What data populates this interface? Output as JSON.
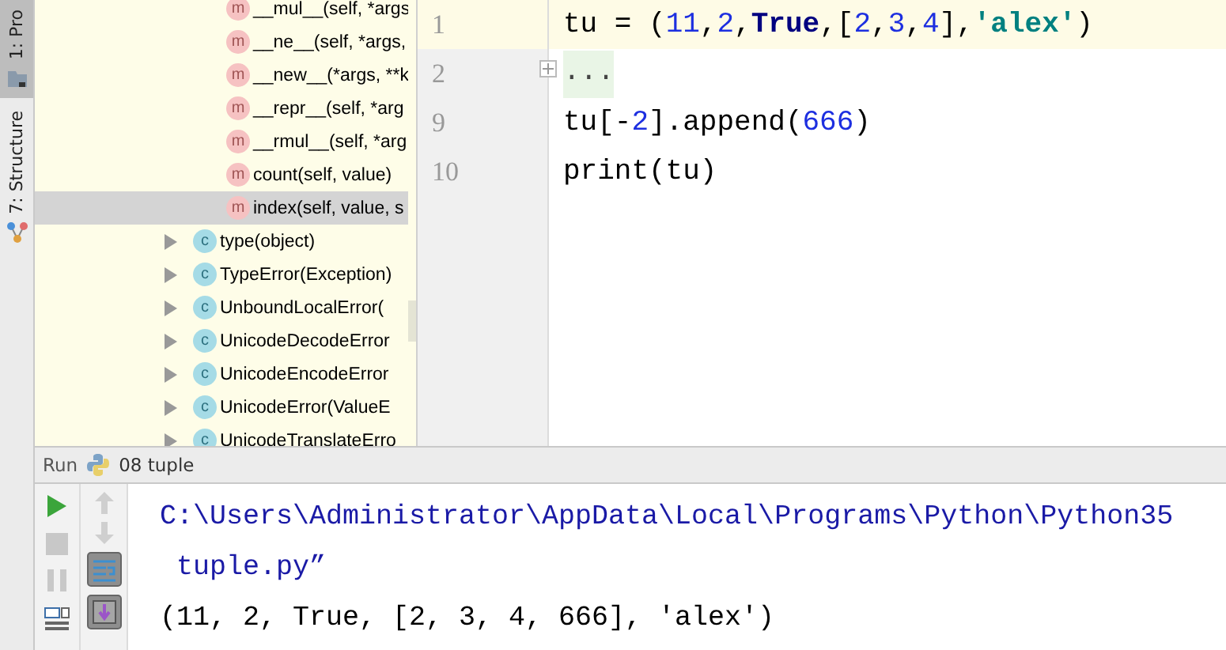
{
  "side_tabs": [
    {
      "label": "1: Pro",
      "selected": true,
      "kind": "project"
    },
    {
      "label": "7: Structure",
      "selected": false,
      "kind": "structure"
    }
  ],
  "structure_tree": [
    {
      "kind": "method",
      "badge": "m",
      "label": "__mul__(self, *args",
      "selected": false
    },
    {
      "kind": "method",
      "badge": "m",
      "label": "__ne__(self, *args,",
      "selected": false
    },
    {
      "kind": "method",
      "badge": "m",
      "label": "__new__(*args, **k",
      "selected": false
    },
    {
      "kind": "method",
      "badge": "m",
      "label": "__repr__(self, *arg",
      "selected": false
    },
    {
      "kind": "method",
      "badge": "m",
      "label": "__rmul__(self, *arg",
      "selected": false
    },
    {
      "kind": "method",
      "badge": "m",
      "label": "count(self, value)",
      "selected": false
    },
    {
      "kind": "method",
      "badge": "m",
      "label": "index(self, value, s",
      "selected": true
    },
    {
      "kind": "class",
      "badge": "c",
      "label": "type(object)",
      "selected": false,
      "expanded": false
    },
    {
      "kind": "class",
      "badge": "c",
      "label": "TypeError(Exception)",
      "selected": false,
      "expanded": false
    },
    {
      "kind": "class",
      "badge": "c",
      "label": "UnboundLocalError(",
      "selected": false,
      "expanded": false
    },
    {
      "kind": "class",
      "badge": "c",
      "label": "UnicodeDecodeError",
      "selected": false,
      "expanded": false
    },
    {
      "kind": "class",
      "badge": "c",
      "label": "UnicodeEncodeError",
      "selected": false,
      "expanded": false
    },
    {
      "kind": "class",
      "badge": "c",
      "label": "UnicodeError(ValueE",
      "selected": false,
      "expanded": false
    },
    {
      "kind": "class",
      "badge": "c",
      "label": "UnicodeTranslateErro",
      "selected": false,
      "expanded": false
    }
  ],
  "editor": {
    "lines": [
      {
        "number": "1",
        "current": true,
        "folded": false,
        "tokens": [
          {
            "text": "tu = (",
            "kind": "plain"
          },
          {
            "text": "11",
            "kind": "number"
          },
          {
            "text": ",",
            "kind": "plain"
          },
          {
            "text": "2",
            "kind": "number"
          },
          {
            "text": ",",
            "kind": "plain"
          },
          {
            "text": "True",
            "kind": "keyword"
          },
          {
            "text": ",[",
            "kind": "plain"
          },
          {
            "text": "2",
            "kind": "number"
          },
          {
            "text": ",",
            "kind": "plain"
          },
          {
            "text": "3",
            "kind": "number"
          },
          {
            "text": ",",
            "kind": "plain"
          },
          {
            "text": "4",
            "kind": "number"
          },
          {
            "text": "],",
            "kind": "plain"
          },
          {
            "text": "'alex'",
            "kind": "string"
          },
          {
            "text": ")",
            "kind": "plain"
          }
        ]
      },
      {
        "number": "2",
        "current": false,
        "folded": true,
        "tokens": [
          {
            "text": "...",
            "kind": "plain"
          }
        ]
      },
      {
        "number": "9",
        "current": false,
        "folded": false,
        "tokens": [
          {
            "text": "tu[-",
            "kind": "plain"
          },
          {
            "text": "2",
            "kind": "number"
          },
          {
            "text": "].append(",
            "kind": "plain"
          },
          {
            "text": "666",
            "kind": "number"
          },
          {
            "text": ")",
            "kind": "plain"
          }
        ]
      },
      {
        "number": "10",
        "current": false,
        "folded": false,
        "tokens": [
          {
            "text": "print(tu)",
            "kind": "plain"
          }
        ]
      }
    ]
  },
  "run_panel": {
    "label": "Run",
    "config": "08 tuple",
    "console": [
      {
        "kind": "system",
        "text": "C:\\Users\\Administrator\\AppData\\Local\\Programs\\Python\\Python35"
      },
      {
        "kind": "system",
        "text": " tuple.py”"
      },
      {
        "kind": "output",
        "text": "(11, 2, True, [2, 3, 4, 666], 'alex')"
      }
    ]
  }
}
